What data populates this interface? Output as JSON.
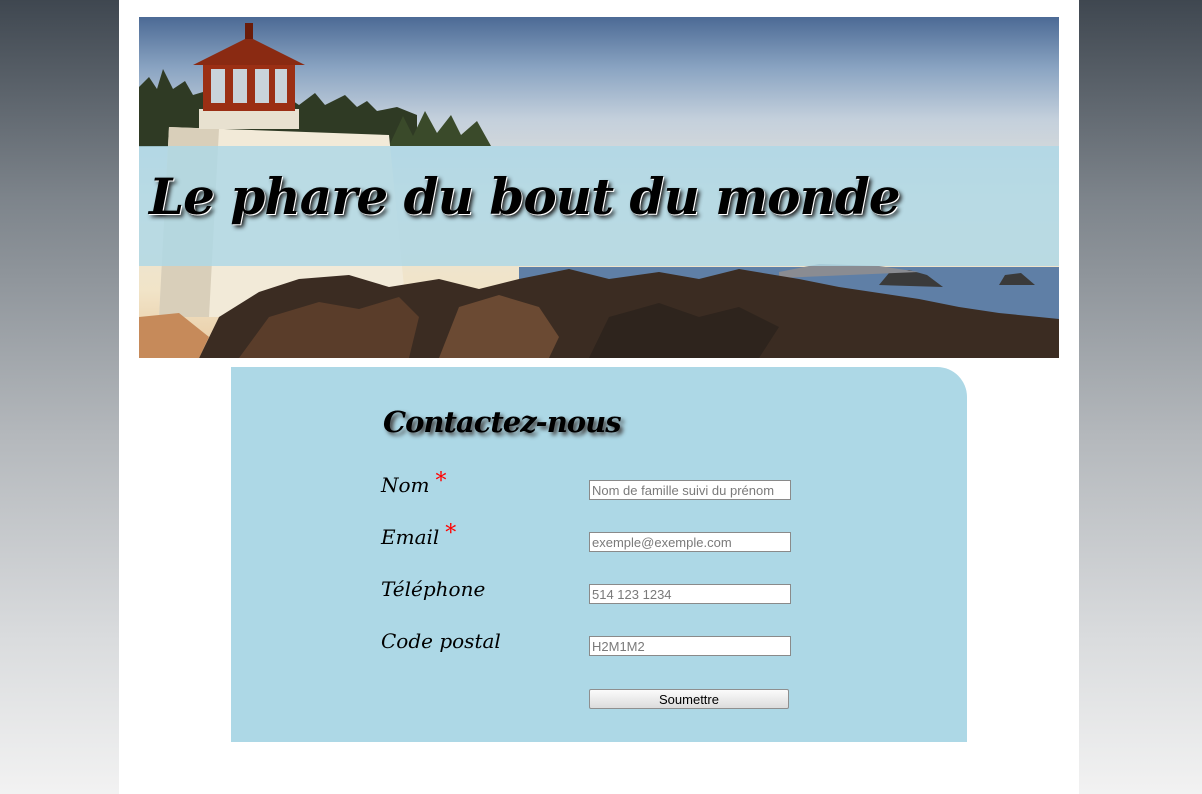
{
  "header": {
    "title": "Le phare du bout du monde"
  },
  "contact": {
    "heading": "Contactez-nous",
    "required_marker": "*",
    "fields": [
      {
        "label": "Nom",
        "required": true,
        "placeholder": "Nom de famille suivi du prénom",
        "value": ""
      },
      {
        "label": "Email",
        "required": true,
        "placeholder": "exemple@exemple.com",
        "value": ""
      },
      {
        "label": "Téléphone",
        "required": false,
        "placeholder": "514 123 1234",
        "value": ""
      },
      {
        "label": "Code postal",
        "required": false,
        "placeholder": "H2M1M2",
        "value": ""
      }
    ],
    "submit_label": "Soumettre"
  },
  "colors": {
    "panel": "#add8e6",
    "required": "#ff0000",
    "page": "#ffffff"
  }
}
